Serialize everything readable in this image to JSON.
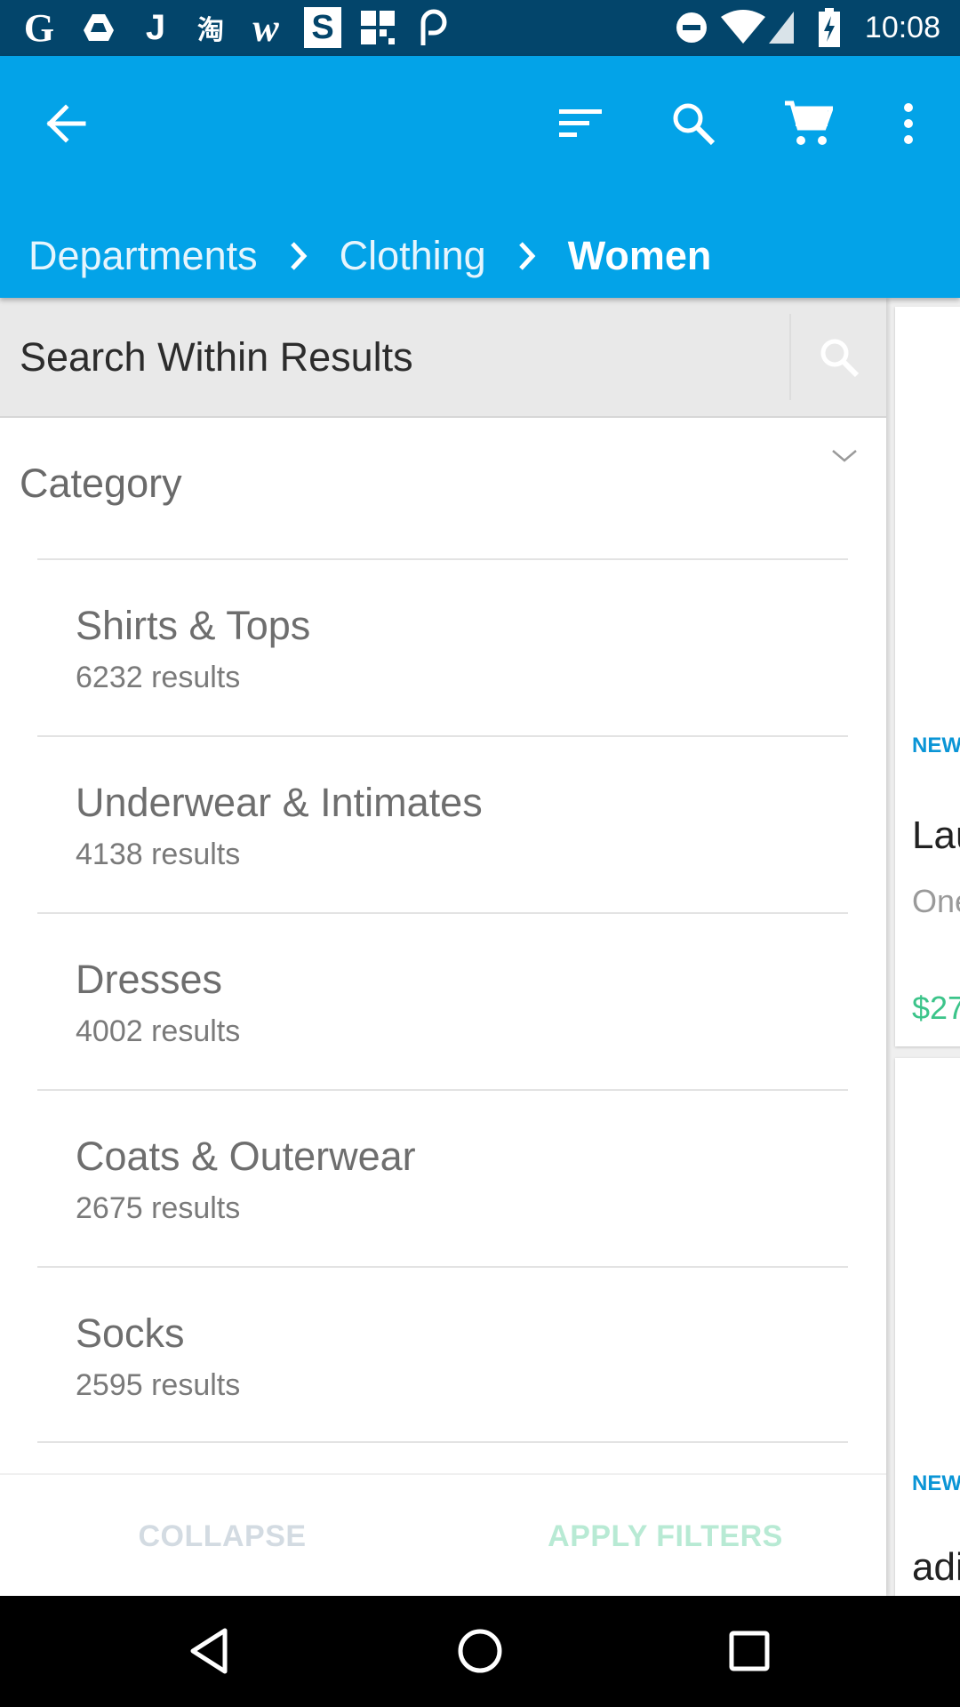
{
  "status_bar": {
    "time": "10:08",
    "notification_icons": [
      "google-icon",
      "drive-icon",
      "j-app-icon",
      "taobao-icon",
      "wish-icon",
      "s-app-icon",
      "grid-app-icon",
      "wallet-app-icon"
    ],
    "system_icons": [
      "do-not-disturb-icon",
      "wifi-icon",
      "signal-icon",
      "battery-charging-icon"
    ]
  },
  "app_bar": {
    "icons": [
      "back-arrow-icon",
      "sort-icon",
      "search-icon",
      "cart-icon",
      "more-vert-icon"
    ],
    "breadcrumb": [
      {
        "label": "Departments"
      },
      {
        "label": "Clothing"
      },
      {
        "label": "Women"
      }
    ]
  },
  "filter_panel": {
    "search_placeholder": "Search Within Results",
    "category_title": "Category",
    "categories": [
      {
        "name": "Shirts & Tops",
        "count": "6232 results"
      },
      {
        "name": "Underwear & Intimates",
        "count": "4138 results"
      },
      {
        "name": "Dresses",
        "count": "4002 results"
      },
      {
        "name": "Coats & Outerwear",
        "count": "2675 results"
      },
      {
        "name": "Socks",
        "count": "2595 results"
      }
    ],
    "collapse_label": "COLLAPSE",
    "apply_label": "APPLY FILTERS"
  },
  "products": [
    {
      "badge": "NEW",
      "title": "Lau",
      "subtitle": "One",
      "price": "$27"
    },
    {
      "badge": "NEW",
      "title": "adi"
    }
  ],
  "colors": {
    "status_bar": "#03456b",
    "app_bar": "#03a3e8",
    "badge": "#0a95d6",
    "price": "#3cc48a"
  }
}
